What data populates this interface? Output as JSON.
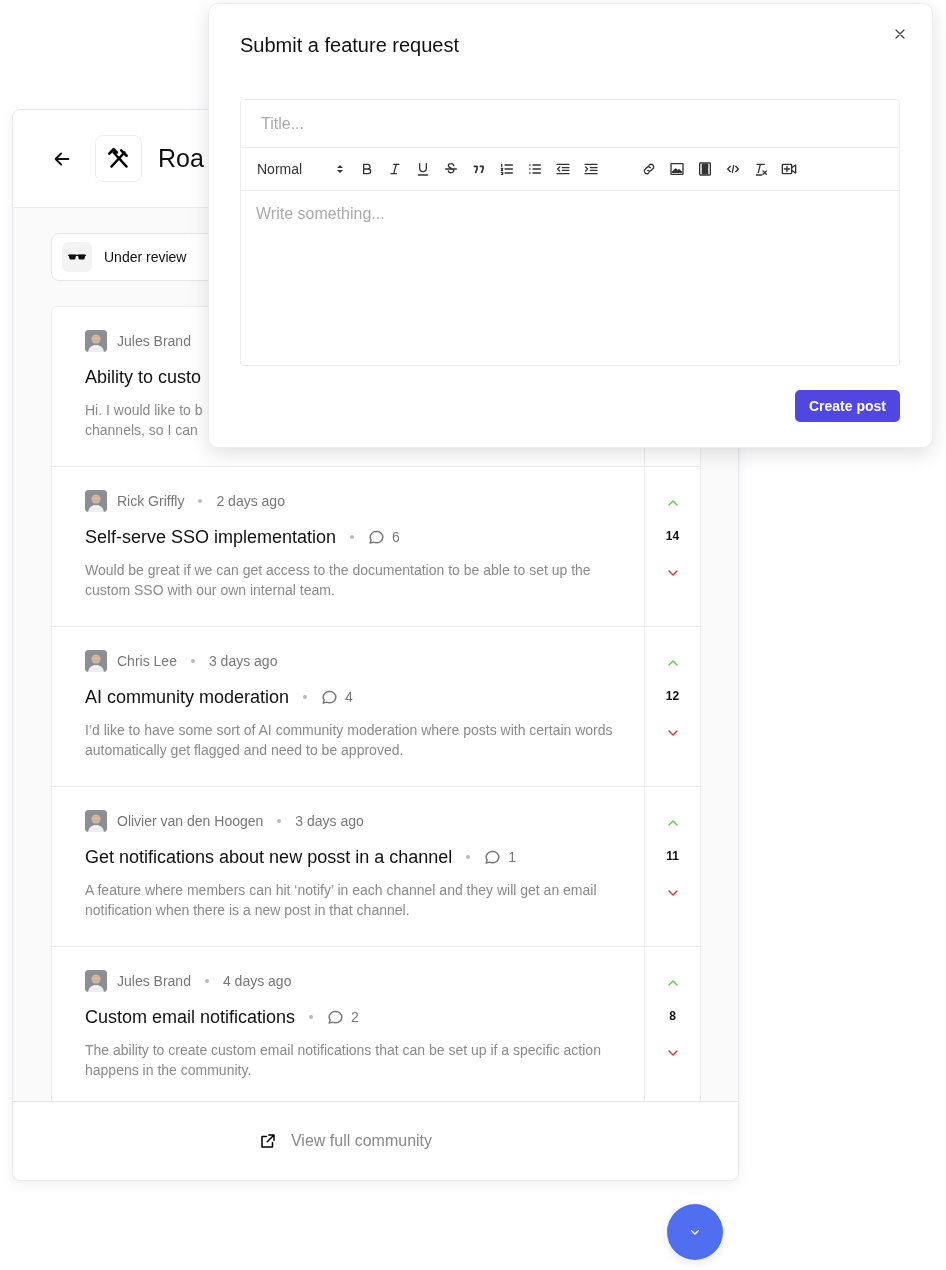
{
  "widget": {
    "title": "Roa",
    "filter": {
      "label": "Under review"
    },
    "posts": [
      {
        "author": "Jules Brand",
        "title": "Ability to custo",
        "body": "Hi. I would like to b\nchannels, so I can"
      },
      {
        "author": "Rick Griffly",
        "time": "2 days ago",
        "title": "Self-serve SSO implementation",
        "comments": "6",
        "body": "Would be great if we can get access to the documentation to be able to set up the custom SSO with our own internal team.",
        "votes": "14"
      },
      {
        "author": "Chris Lee",
        "time": "3 days ago",
        "title": "AI community moderation",
        "comments": "4",
        "body": "I’d like to have some sort of AI community moderation where posts with certain words automatically get flagged and need to be approved.",
        "votes": "12"
      },
      {
        "author": "Olivier van den Hoogen",
        "time": "3 days ago",
        "title": "Get notifications about new posst in a channel",
        "comments": "1",
        "body": "A feature where members can hit ‘notify’ in each channel and they will get an email notification when there is a new post in that channel.",
        "votes": "11"
      },
      {
        "author": "Jules Brand",
        "time": "4 days ago",
        "title": "Custom email notifications",
        "comments": "2",
        "body": "The ability to create custom email notifications that can be set up if a specific action happens in the community.",
        "votes": "8"
      }
    ],
    "footer_link": "View full community"
  },
  "modal": {
    "title": "Submit a feature request",
    "title_field": {
      "placeholder": "Title..."
    },
    "format_select": "Normal",
    "editor": {
      "placeholder": "Write something..."
    },
    "submit_button": "Create post"
  }
}
